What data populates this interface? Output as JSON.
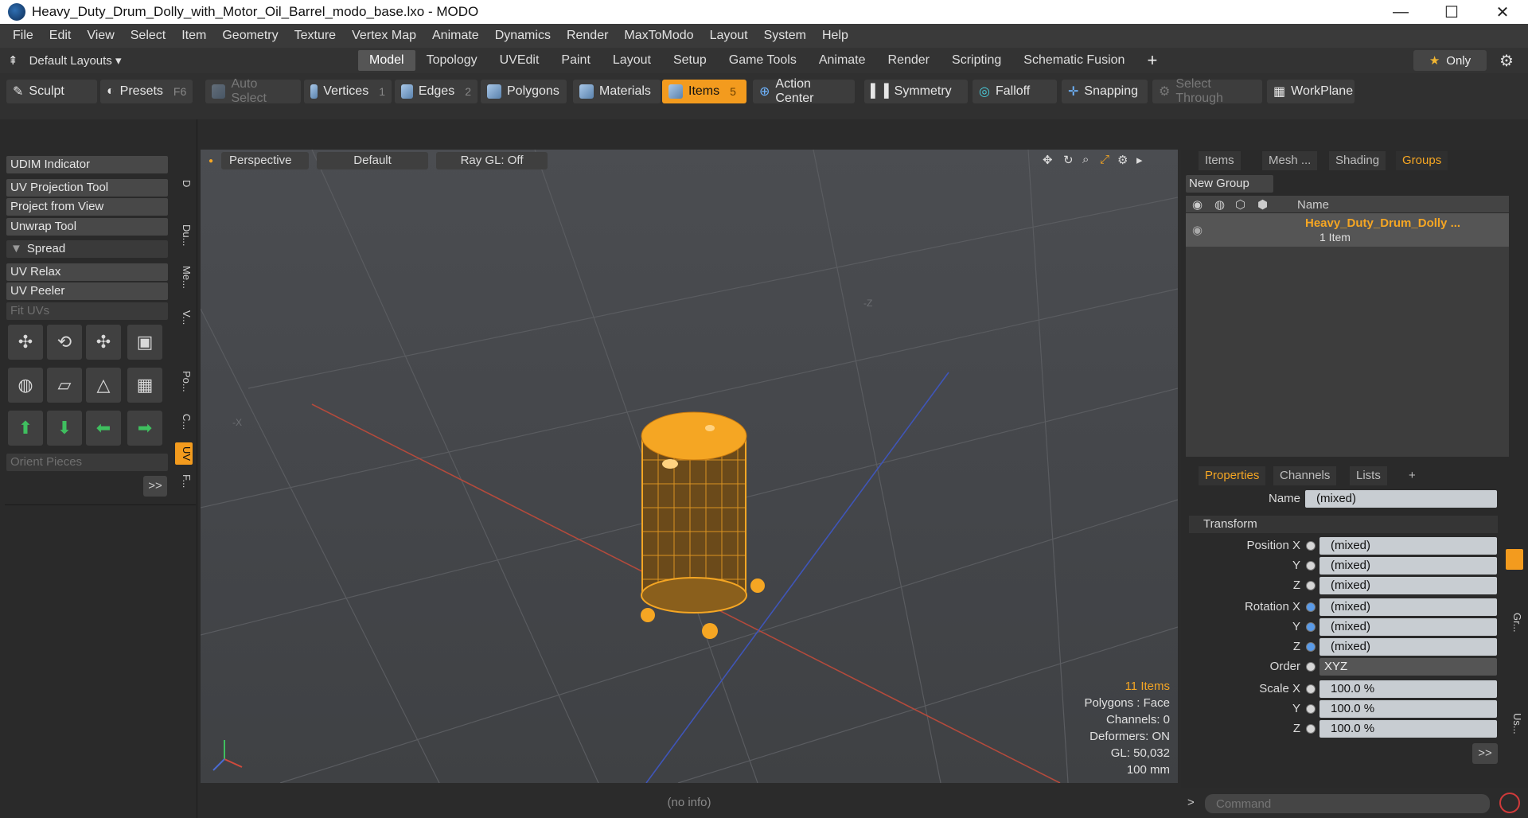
{
  "window": {
    "title": "Heavy_Duty_Drum_Dolly_with_Motor_Oil_Barrel_modo_base.lxo - MODO",
    "minimize": "—",
    "maximize": "☐",
    "close": "✕"
  },
  "menu": [
    "File",
    "Edit",
    "View",
    "Select",
    "Item",
    "Geometry",
    "Texture",
    "Vertex Map",
    "Animate",
    "Dynamics",
    "Render",
    "MaxToModo",
    "Layout",
    "System",
    "Help"
  ],
  "layoutbar": {
    "layouts_label": "Default Layouts ▾",
    "tabs": [
      "Model",
      "Topology",
      "UVEdit",
      "Paint",
      "Layout",
      "Setup",
      "Game Tools",
      "Animate",
      "Render",
      "Scripting",
      "Schematic Fusion"
    ],
    "active_tab": "Model",
    "add_tab": "+",
    "only_label": "Only"
  },
  "toolbar": {
    "sculpt": "Sculpt",
    "presets": "Presets",
    "presets_key": "F6",
    "auto_select": "Auto Select",
    "vertices": "Vertices",
    "vertices_num": "1",
    "edges": "Edges",
    "edges_num": "2",
    "polygons": "Polygons",
    "materials": "Materials",
    "items": "Items",
    "items_num": "5",
    "action_center": "Action Center",
    "symmetry": "Symmetry",
    "falloff": "Falloff",
    "snapping": "Snapping",
    "select_through": "Select Through",
    "workplane": "WorkPlane"
  },
  "leftpanel": {
    "udim": "UDIM Indicator",
    "uv_projection": "UV Projection Tool",
    "project_from_view": "Project from View",
    "unwrap": "Unwrap Tool",
    "spread": "Spread",
    "uv_relax": "UV Relax",
    "uv_peeler": "UV Peeler",
    "fit_uvs": "Fit UVs",
    "orient_pieces": "Orient Pieces",
    "more": ">>",
    "vtabs": [
      "D",
      "Du...",
      "Me...",
      "V...",
      "Po...",
      "C...",
      "UV",
      "F..."
    ]
  },
  "viewport": {
    "view": "Perspective",
    "shading": "Default",
    "raygl": "Ray GL: Off",
    "axis_neg_z": "-Z",
    "axis_neg_x": "-X",
    "info": {
      "items": "11 Items",
      "polygons": "Polygons : Face",
      "channels": "Channels: 0",
      "deformers": "Deformers: ON",
      "gl": "GL: 50,032",
      "scale": "100 mm"
    }
  },
  "rightpanel": {
    "tabs": [
      "Items",
      "Mesh ...",
      "Shading",
      "Groups"
    ],
    "active_tab": "Groups",
    "new_group": "New Group",
    "name_col": "Name",
    "group_name": "Heavy_Duty_Drum_Dolly ...",
    "group_count": "1 Item",
    "prop_tabs": [
      "Properties",
      "Channels",
      "Lists"
    ],
    "prop_add": "+",
    "name_label": "Name",
    "name_value": "(mixed)",
    "transform": "Transform",
    "position_x": "Position X",
    "y": "Y",
    "z": "Z",
    "rotation_x": "Rotation X",
    "order": "Order",
    "order_value": "XYZ",
    "scale_x": "Scale X",
    "mixed": "(mixed)",
    "scale_value": "100.0 %",
    "more": ">>",
    "side_tabs": [
      "Gr...",
      "Us..."
    ]
  },
  "status": {
    "info": "(no info)",
    "command_placeholder": "Command"
  },
  "colors": {
    "accent": "#f39b1e",
    "selection": "#f5a623"
  }
}
